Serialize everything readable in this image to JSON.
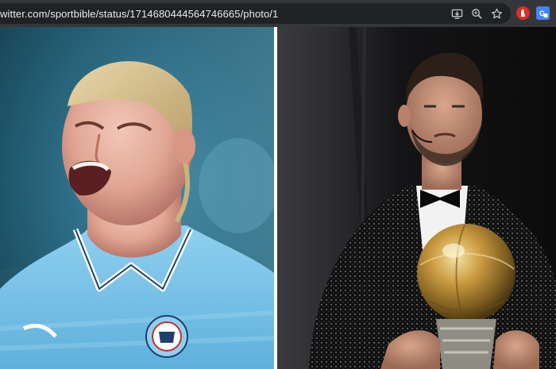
{
  "browser": {
    "url": "witter.com/sportbible/status/1714680444564746665/photo/1",
    "icons": [
      "install-app-icon",
      "zoom-icon",
      "bookmark-star-icon"
    ],
    "extensions": [
      {
        "name": "ublock-extension-icon",
        "color": "#d93025"
      },
      {
        "name": "translate-extension-icon",
        "color": "#4285f4"
      }
    ]
  },
  "photo": {
    "left_subject": "footballer in light blue jersey shouting",
    "right_subject": "man in sequined tuxedo holding golden ball trophy"
  },
  "colors": {
    "chrome_bg": "#35363a",
    "url_bg": "#202124",
    "jersey_blue": "#7cc4e8",
    "trophy_gold": "#c9a24a"
  }
}
